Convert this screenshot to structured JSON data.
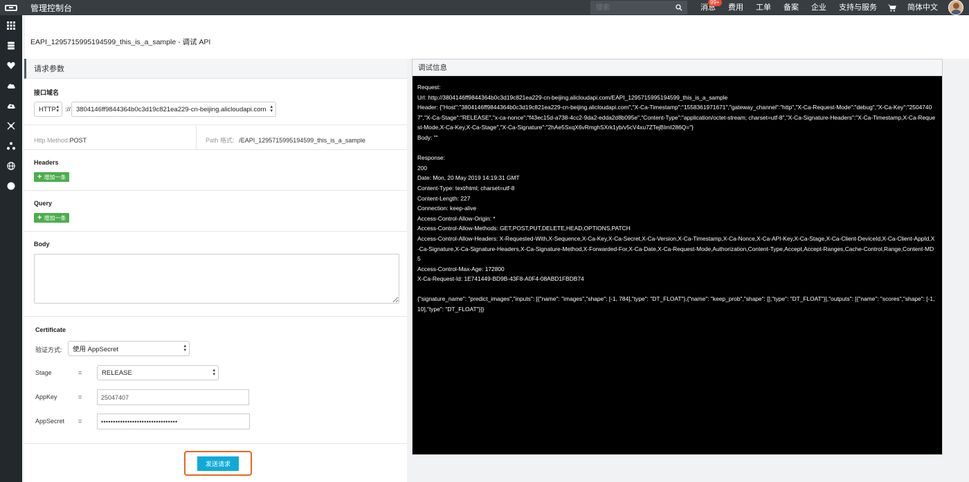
{
  "topbar": {
    "console_title": "管理控制台",
    "search_placeholder": "搜索",
    "nav": [
      "消息",
      "费用",
      "工单",
      "备案",
      "企业",
      "支持与服务"
    ],
    "badge": "99+",
    "language": "简体中文"
  },
  "sidebar": {
    "icons": [
      "grid-icon",
      "database-icon",
      "heart-icon",
      "cloud-icon",
      "cloud-upload-icon",
      "network-icon",
      "cluster-icon",
      "globe-icon",
      "circle-icon"
    ]
  },
  "page": {
    "title": "EAPI_1295715995194599_this_is_a_sample - 调试 API"
  },
  "request": {
    "panel_title": "请求参数",
    "domain_label": "接口域名",
    "protocol": "HTTP",
    "protocol_sep": "://",
    "domain": "3804146ff9844364b0c3d19c821ea229-cn-beijing.alicloudapi.com",
    "http_method_label": "Http Method:",
    "http_method_value": "POST",
    "path_label": "Path 格式:",
    "path_value": "/EAPI_1295715995194599_this_is_a_sample",
    "headers_label": "Headers",
    "query_label": "Query",
    "add_label": "增加一条",
    "body_label": "Body",
    "certificate_label": "Certificate",
    "auth_label": "验证方式:",
    "auth_value": "使用 AppSecret",
    "stage_label": "Stage",
    "stage_value": "RELEASE",
    "appkey_label": "AppKey",
    "appkey_value": "25047407",
    "appsecret_label": "AppSecret",
    "appsecret_value": "••••••••••••••••••••••••••••••••",
    "eq": "=",
    "send_label": "发送请求"
  },
  "debug": {
    "title": "调试信息",
    "lines": [
      "Request:",
      "Url: http://3804146ff9844364b0c3d19c821ea229-cn-beijing.alicloudapi.com/EAPI_1295715995194599_this_is_a_sample",
      "Header: {\"Host\":\"3804146ff9844364b0c3d19c821ea229-cn-beijing.alicloudapi.com\",\"X-Ca-Timestamp\":\"1558361971671\",\"gateway_channel\":\"http\",\"X-Ca-Request-Mode\":\"debug\",\"X-Ca-Key\":\"25047407\",\"X-Ca-Stage\":\"RELEASE\",\"x-ca-nonce\":\"f43ec15d-a738-4cc2-9da2-edda2d8b095e\",\"Content-Type\":\"application/octet-stream; charset=utf-8\",\"X-Ca-Signature-Headers\":\"X-Ca-Timestamp,X-Ca-Request-Mode,X-Ca-Key,X-Ca-Stage\",\"X-Ca-Signature\":\"2hAe5SxqX6vRmghSXrk1yb/v5cV4xu7ZTejBImI286Q=\"}",
      "Body: \"\"",
      "",
      "Response:",
      "200",
      "Date: Mon, 20 May 2019 14:19:31 GMT",
      "Content-Type: text/html; charset=utf-8",
      "Content-Length: 227",
      "Connection: keep-alive",
      "Access-Control-Allow-Origin: *",
      "Access-Control-Allow-Methods: GET,POST,PUT,DELETE,HEAD,OPTIONS,PATCH",
      "Access-Control-Allow-Headers: X-Requested-With,X-Sequence,X-Ca-Key,X-Ca-Secret,X-Ca-Version,X-Ca-Timestamp,X-Ca-Nonce,X-Ca-API-Key,X-Ca-Stage,X-Ca-Client-DeviceId,X-Ca-Client-AppId,X-Ca-Signature,X-Ca-Signature-Headers,X-Ca-Signature-Method,X-Forwarded-For,X-Ca-Date,X-Ca-Request-Mode,Authorization,Content-Type,Accept,Accept-Ranges,Cache-Control,Range,Content-MD5",
      "Access-Control-Max-Age: 172800",
      "X-Ca-Request-Id: 1E741449-BD9B-43F8-A0F4-08ABD1FBDB74",
      "",
      "{\"signature_name\": \"predict_images\",\"inputs\": [{\"name\": \"images\",\"shape\": [-1, 784],\"type\": \"DT_FLOAT\"},{\"name\": \"keep_prob\",\"shape\": [],\"type\": \"DT_FLOAT\"}],\"outputs\": [{\"name\": \"scores\",\"shape\": [-1, 10],\"type\": \"DT_FLOAT\"}]}"
    ]
  }
}
